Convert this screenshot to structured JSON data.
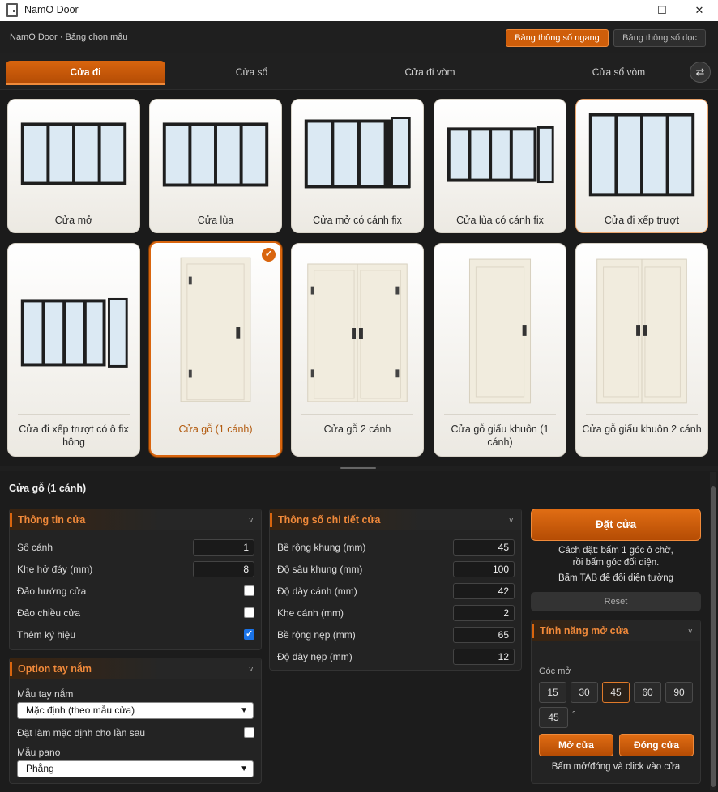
{
  "window": {
    "title": "NamO Door",
    "minimize": "—",
    "maximize": "☐",
    "close": "✕"
  },
  "header": {
    "breadcrumb": "NamO Door · Bảng chọn mẫu",
    "btn_horizontal": "Bảng thông số ngang",
    "btn_vertical": "Bảng thông số dọc"
  },
  "tabs": [
    {
      "label": "Cửa đi"
    },
    {
      "label": "Cửa sổ"
    },
    {
      "label": "Cửa đi vòm"
    },
    {
      "label": "Cửa sổ vòm"
    }
  ],
  "swap_icon": "⇄",
  "cards": [
    {
      "label": "Cửa mở"
    },
    {
      "label": "Cửa lùa"
    },
    {
      "label": "Cửa mở có cánh fix"
    },
    {
      "label": "Cửa lùa có cánh fix"
    },
    {
      "label": "Cửa đi xếp trượt"
    },
    {
      "label": "Cửa đi xếp trượt có ô fix hông"
    },
    {
      "label": "Cửa gỗ (1 cánh)"
    },
    {
      "label": "Cửa gỗ 2 cánh"
    },
    {
      "label": "Cửa gỗ giấu khuôn (1 cánh)"
    },
    {
      "label": "Cửa gỗ giấu khuôn 2 cánh"
    }
  ],
  "selected_check": "✓",
  "section_title": "Cửa gỗ (1 cánh)",
  "door_info": {
    "title": "Thông tin cửa",
    "chevron": "v",
    "rows": [
      {
        "label": "Số cánh",
        "value": "1"
      },
      {
        "label": "Khe hở đáy (mm)",
        "value": "8"
      }
    ],
    "checks": [
      {
        "label": "Đảo hướng cửa",
        "checked": false
      },
      {
        "label": "Đảo chiều cửa",
        "checked": false
      },
      {
        "label": "Thêm ký hiệu",
        "checked": true
      }
    ]
  },
  "handle": {
    "title": "Option tay nắm",
    "chevron": "v",
    "model_label": "Mẫu tay nắm",
    "model_value": "Mặc định (theo mẫu cửa)",
    "default_label": "Đặt làm mặc định cho lần sau",
    "default_checked": false,
    "pano_label": "Mẫu pano",
    "pano_value": "Phẳng"
  },
  "details": {
    "title": "Thông số chi tiết cửa",
    "chevron": "v",
    "rows": [
      {
        "label": "Bề rộng khung (mm)",
        "value": "45"
      },
      {
        "label": "Độ sâu khung (mm)",
        "value": "100"
      },
      {
        "label": "Độ dày cánh (mm)",
        "value": "42"
      },
      {
        "label": "Khe cánh (mm)",
        "value": "2"
      },
      {
        "label": "Bề rộng nẹp (mm)",
        "value": "65"
      },
      {
        "label": "Độ dày nẹp (mm)",
        "value": "12"
      }
    ]
  },
  "place": {
    "button": "Đặt cửa",
    "hint1": "Cách đặt: bấm 1 góc ô chờ,",
    "hint2": "rồi bấm góc đối diện.",
    "hint3": "Bấm TAB để đổi diện tường",
    "reset": "Reset"
  },
  "open_feature": {
    "title": "Tính năng mở cửa",
    "chevron": "v",
    "angle_label": "Góc mở",
    "angles": [
      "15",
      "30",
      "45",
      "60",
      "90"
    ],
    "selected_angle": "45",
    "custom_angle": "45",
    "degree": "°",
    "open_btn": "Mở cửa",
    "close_btn": "Đóng cửa",
    "hint": "Bấm mở/đóng và click vào cửa"
  },
  "colors": {
    "accent": "#d9650e",
    "accent_light": "#f0893a",
    "bg": "#1c1c1c"
  }
}
